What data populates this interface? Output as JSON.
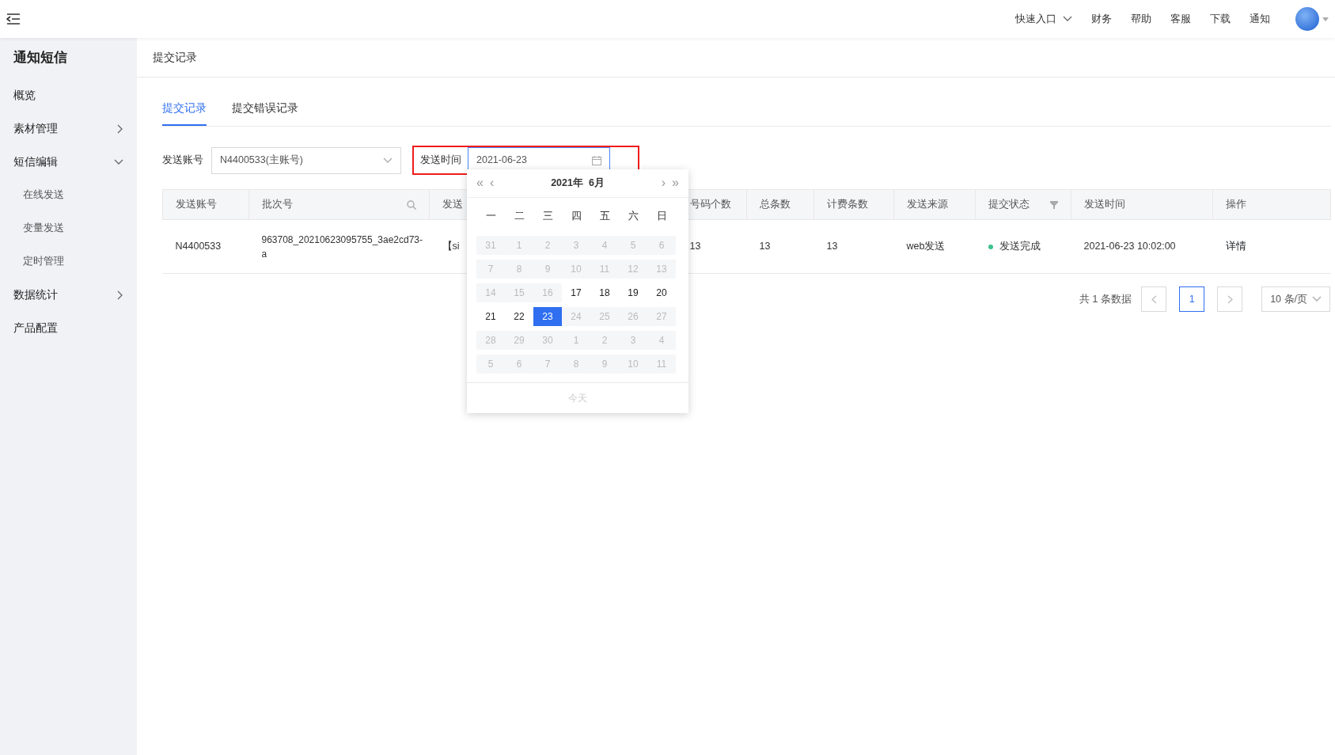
{
  "topbar": {
    "quick_entry": "快速入口",
    "links": [
      "财务",
      "帮助",
      "客服",
      "下载",
      "通知"
    ]
  },
  "sidebar": {
    "title": "通知短信",
    "items": [
      {
        "label": "概览",
        "kind": "leaf",
        "selected": false
      },
      {
        "label": "素材管理",
        "kind": "group",
        "expanded": false,
        "selected": false
      },
      {
        "label": "短信编辑",
        "kind": "group",
        "expanded": true,
        "selected": false,
        "children": [
          {
            "label": "在线发送",
            "selected": false
          },
          {
            "label": "变量发送",
            "selected": false
          },
          {
            "label": "定时管理",
            "selected": false
          }
        ]
      },
      {
        "label": "数据统计",
        "kind": "group",
        "expanded": false,
        "selected": false
      },
      {
        "label": "产品配置",
        "kind": "leaf",
        "selected": false
      }
    ]
  },
  "page_title": "提交记录",
  "tabs": [
    {
      "label": "提交记录",
      "selected": true
    },
    {
      "label": "提交错误记录",
      "selected": false
    }
  ],
  "filters": {
    "account": {
      "label": "发送账号",
      "value": "N4400533(主账号)"
    },
    "time": {
      "label": "发送时间",
      "value": "2021-06-23"
    }
  },
  "calendar": {
    "title": "2021年  6月",
    "nav": [
      "«",
      "‹",
      "›",
      "»"
    ],
    "weekdays": [
      "一",
      "二",
      "三",
      "四",
      "五",
      "六",
      "日"
    ],
    "weeks": [
      [
        {
          "text": "31",
          "disabled": true,
          "selected": false
        },
        {
          "text": "1",
          "disabled": true,
          "selected": false
        },
        {
          "text": "2",
          "disabled": true,
          "selected": false
        },
        {
          "text": "3",
          "disabled": true,
          "selected": false
        },
        {
          "text": "4",
          "disabled": true,
          "selected": false
        },
        {
          "text": "5",
          "disabled": true,
          "selected": false
        },
        {
          "text": "6",
          "disabled": true,
          "selected": false
        }
      ],
      [
        {
          "text": "7",
          "disabled": true,
          "selected": false
        },
        {
          "text": "8",
          "disabled": true,
          "selected": false
        },
        {
          "text": "9",
          "disabled": true,
          "selected": false
        },
        {
          "text": "10",
          "disabled": true,
          "selected": false
        },
        {
          "text": "11",
          "disabled": true,
          "selected": false
        },
        {
          "text": "12",
          "disabled": true,
          "selected": false
        },
        {
          "text": "13",
          "disabled": true,
          "selected": false
        }
      ],
      [
        {
          "text": "14",
          "disabled": true,
          "selected": false
        },
        {
          "text": "15",
          "disabled": true,
          "selected": false
        },
        {
          "text": "16",
          "disabled": true,
          "selected": false
        },
        {
          "text": "17",
          "disabled": false,
          "selected": false
        },
        {
          "text": "18",
          "disabled": false,
          "selected": false
        },
        {
          "text": "19",
          "disabled": false,
          "selected": false
        },
        {
          "text": "20",
          "disabled": false,
          "selected": false
        }
      ],
      [
        {
          "text": "21",
          "disabled": false,
          "selected": false
        },
        {
          "text": "22",
          "disabled": false,
          "selected": false
        },
        {
          "text": "23",
          "disabled": false,
          "selected": true
        },
        {
          "text": "24",
          "disabled": true,
          "selected": false
        },
        {
          "text": "25",
          "disabled": true,
          "selected": false
        },
        {
          "text": "26",
          "disabled": true,
          "selected": false
        },
        {
          "text": "27",
          "disabled": true,
          "selected": false
        }
      ],
      [
        {
          "text": "28",
          "disabled": true,
          "selected": false
        },
        {
          "text": "29",
          "disabled": true,
          "selected": false
        },
        {
          "text": "30",
          "disabled": true,
          "selected": false
        },
        {
          "text": "1",
          "disabled": true,
          "selected": false
        },
        {
          "text": "2",
          "disabled": true,
          "selected": false
        },
        {
          "text": "3",
          "disabled": true,
          "selected": false
        },
        {
          "text": "4",
          "disabled": true,
          "selected": false
        }
      ],
      [
        {
          "text": "5",
          "disabled": true,
          "selected": false
        },
        {
          "text": "6",
          "disabled": true,
          "selected": false
        },
        {
          "text": "7",
          "disabled": true,
          "selected": false
        },
        {
          "text": "8",
          "disabled": true,
          "selected": false
        },
        {
          "text": "9",
          "disabled": true,
          "selected": false
        },
        {
          "text": "10",
          "disabled": true,
          "selected": false
        },
        {
          "text": "11",
          "disabled": true,
          "selected": false
        }
      ]
    ],
    "today": {
      "label": "今天",
      "disabled": true
    }
  },
  "table": {
    "columns": [
      {
        "label": "发送账号",
        "kind": "plain"
      },
      {
        "label": "批次号",
        "kind": "search"
      },
      {
        "label": "发送",
        "kind": "plain"
      },
      {
        "label": "号码个数",
        "kind": "plain"
      },
      {
        "label": "总条数",
        "kind": "plain"
      },
      {
        "label": "计费条数",
        "kind": "plain"
      },
      {
        "label": "发送来源",
        "kind": "plain"
      },
      {
        "label": "提交状态",
        "kind": "filter"
      },
      {
        "label": "发送时间",
        "kind": "plain"
      },
      {
        "label": "操作",
        "kind": "plain"
      }
    ],
    "rows": [
      {
        "cells": [
          "N4400533",
          "963708_20210623095755_3ae2cd73-a",
          "【si",
          "13",
          "13",
          "13",
          "web发送",
          "发送完成",
          "2021-06-23 10:02:00",
          "详情"
        ],
        "color": "#3cc18a"
      }
    ]
  },
  "pagination": {
    "total": "共 1 条数据",
    "pages": [
      {
        "label": "1",
        "selected": true
      }
    ],
    "page_size": "10 条/页"
  }
}
